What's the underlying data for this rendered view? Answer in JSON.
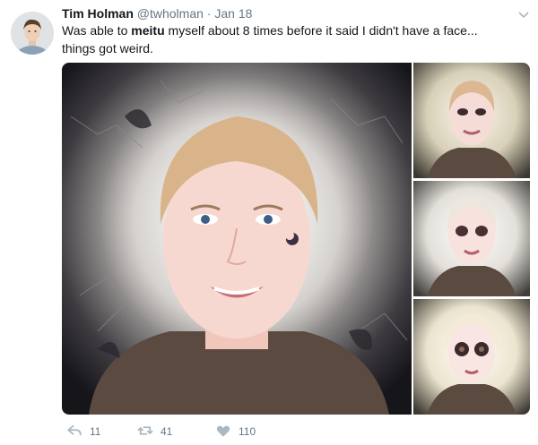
{
  "tweet": {
    "author": {
      "name": "Tim Holman",
      "handle": "@twholman",
      "separator": "·",
      "timestamp": "Jan 18"
    },
    "text": {
      "part1": "Was able to ",
      "bold": "meitu",
      "part2": " myself about 8 times before it said I didn't have a face...",
      "line2": "things got weird."
    },
    "actions": {
      "reply": {
        "icon": "reply-icon",
        "count": "11"
      },
      "retweet": {
        "icon": "retweet-icon",
        "count": "41"
      },
      "like": {
        "icon": "heart-icon",
        "count": "110"
      }
    },
    "colors": {
      "text": "#14171a",
      "muted": "#657786",
      "background": "#ffffff"
    }
  }
}
